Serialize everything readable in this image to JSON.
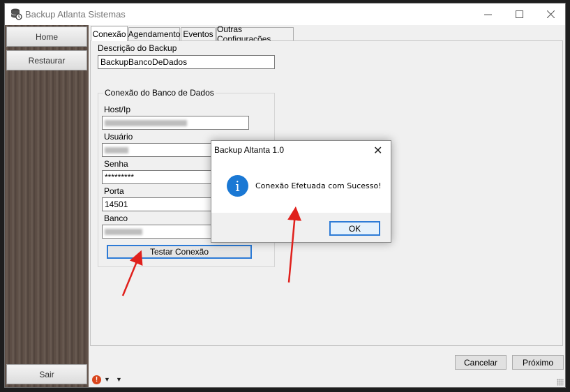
{
  "window": {
    "title": "Backup Atlanta Sistemas",
    "app_icon": "database-backup-icon"
  },
  "sidebar": {
    "items": [
      {
        "label": "Home"
      },
      {
        "label": "Restaurar"
      }
    ],
    "exit_label": "Sair"
  },
  "tabs": [
    {
      "label": "Conexão",
      "active": true
    },
    {
      "label": "Agendamento"
    },
    {
      "label": "Eventos"
    },
    {
      "label": "Outras Configurações"
    }
  ],
  "form": {
    "description_label": "Descrição do Backup",
    "description_value": "BackupBancoDeDados",
    "group_title": "Conexão do Banco de Dados",
    "host_label": "Host/Ip",
    "user_label": "Usuário",
    "password_label": "Senha",
    "password_value": "*********",
    "port_label": "Porta",
    "port_value": "14501",
    "database_label": "Banco",
    "test_button": "Testar Conexão"
  },
  "footer": {
    "cancel_label": "Cancelar",
    "next_label": "Próximo"
  },
  "dialog": {
    "title": "Backup Altanta 1.0",
    "message": "Conexão Efetuada com Sucesso!",
    "ok_label": "OK",
    "icon": "info-icon",
    "close_glyph": "✕"
  },
  "status_bar": {
    "icon": "alert-icon"
  },
  "colors": {
    "accent": "#2d7bd6",
    "info": "#1a78d4",
    "arrow": "#e0201c",
    "sidebar_wood": "#5a4c44"
  }
}
